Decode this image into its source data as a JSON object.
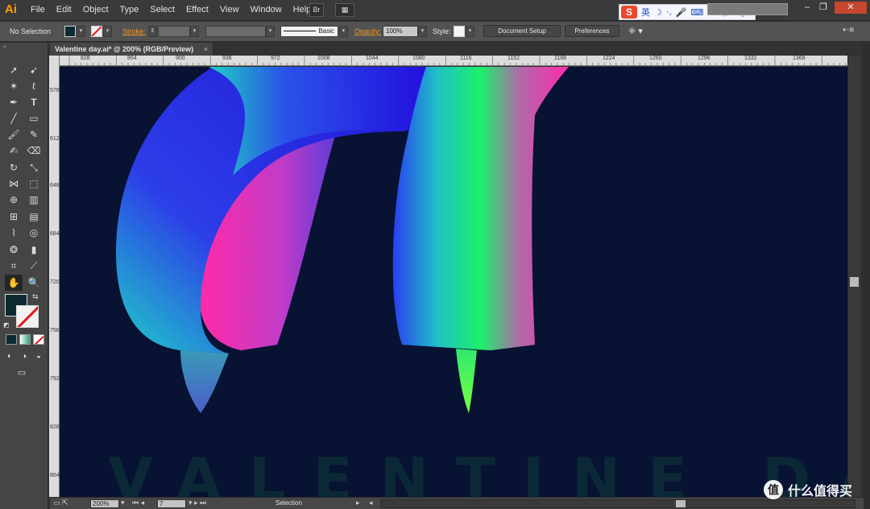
{
  "app": {
    "logo": "Ai"
  },
  "menu": [
    "File",
    "Edit",
    "Object",
    "Type",
    "Select",
    "Effect",
    "View",
    "Window",
    "Help"
  ],
  "menubar_buttons": {
    "bridge": "Br",
    "arrange": "▦"
  },
  "ime": {
    "logo": "S",
    "lang": "英",
    "glyphs": [
      "☽",
      "·,",
      "🎤",
      "⌨",
      "☗",
      "👕",
      "🔧"
    ]
  },
  "window_controls": {
    "minimize": "–",
    "restore": "❐",
    "close": "✕"
  },
  "control_bar": {
    "selection": "No Selection",
    "stroke_label": "Stroke:",
    "brush": "Basic",
    "opacity_label": "Opacity:",
    "opacity_value": "100%",
    "style_label": "Style:",
    "document_setup": "Document Setup",
    "preferences": "Preferences",
    "fill_color": "#0d2a33",
    "accent_orange": "#f09a2a"
  },
  "document_tab": {
    "title": "Valentine day.ai* @ 200% (RGB/Preview)",
    "close": "×"
  },
  "ruler": {
    "h_labels": [
      "828",
      "864",
      "900",
      "936",
      "972",
      "1008",
      "1044",
      "1080",
      "1116",
      "1152",
      "1188",
      "1224",
      "1260",
      "1296",
      "1332",
      "1368"
    ],
    "v_labels": [
      "576",
      "612",
      "648",
      "684",
      "720",
      "756",
      "792",
      "828",
      "864"
    ]
  },
  "canvas": {
    "background": "#081232",
    "watermark": "VALENTINE DA"
  },
  "status_bar": {
    "zoom": "200%",
    "artboard": "7",
    "tool": "Selection"
  },
  "brand": {
    "mark": "值",
    "text": "什么值得买"
  }
}
